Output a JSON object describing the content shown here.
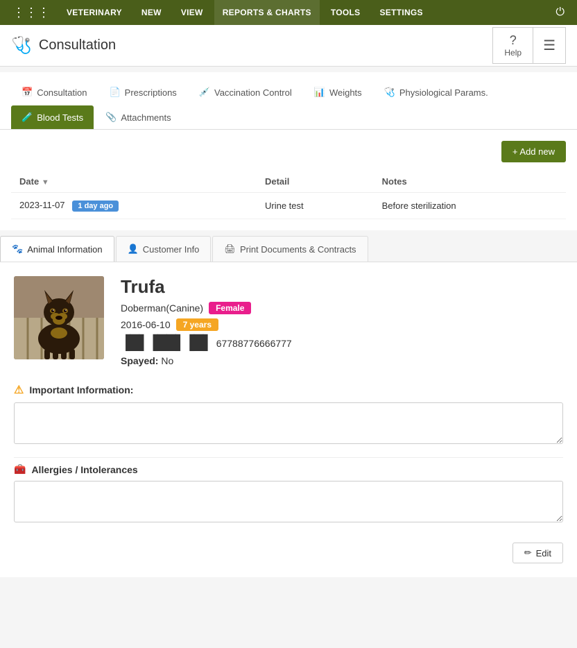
{
  "topNav": {
    "items": [
      {
        "id": "veterinary",
        "label": "VETERINARY"
      },
      {
        "id": "new",
        "label": "NEW"
      },
      {
        "id": "view",
        "label": "VIEW"
      },
      {
        "id": "reports",
        "label": "REPORTS & CHARTS",
        "active": true
      },
      {
        "id": "tools",
        "label": "TOOLS"
      },
      {
        "id": "settings",
        "label": "SETTINGS"
      }
    ]
  },
  "header": {
    "title": "Consultation",
    "helpLabel": "Help"
  },
  "mainTabs": [
    {
      "id": "consultation",
      "label": "Consultation",
      "icon": "calendar"
    },
    {
      "id": "prescriptions",
      "label": "Prescriptions",
      "icon": "file"
    },
    {
      "id": "vaccination",
      "label": "Vaccination Control",
      "icon": "syringe"
    },
    {
      "id": "weights",
      "label": "Weights",
      "icon": "chart"
    },
    {
      "id": "physiological",
      "label": "Physiological Params.",
      "icon": "stethoscope"
    },
    {
      "id": "bloodtests",
      "label": "Blood Tests",
      "icon": "flask",
      "active": true
    },
    {
      "id": "attachments",
      "label": "Attachments",
      "icon": "paperclip"
    }
  ],
  "table": {
    "addNewLabel": "+ Add new",
    "columns": [
      {
        "id": "date",
        "label": "Date",
        "sortable": true
      },
      {
        "id": "detail",
        "label": "Detail"
      },
      {
        "id": "notes",
        "label": "Notes"
      }
    ],
    "rows": [
      {
        "date": "2023-11-07",
        "badge": "1 day ago",
        "detail": "Urine test",
        "notes": "Before sterilization"
      }
    ]
  },
  "bottomTabs": [
    {
      "id": "animal",
      "label": "Animal Information",
      "icon": "paw",
      "active": true
    },
    {
      "id": "customer",
      "label": "Customer Info",
      "icon": "person"
    },
    {
      "id": "print",
      "label": "Print Documents & Contracts",
      "icon": "print"
    }
  ],
  "animal": {
    "name": "Trufa",
    "breed": "Doberman(Canine)",
    "genderBadge": "Female",
    "dob": "2016-06-10",
    "ageBadge": "7 years",
    "barcode": "67788776666777",
    "spayedLabel": "Spayed:",
    "spayedValue": "No",
    "importantInfoTitle": "Important Information:",
    "importantInfoValue": "",
    "allergiesTitle": "Allergies / Intolerances",
    "allergiesValue": "",
    "editLabel": "Edit"
  }
}
